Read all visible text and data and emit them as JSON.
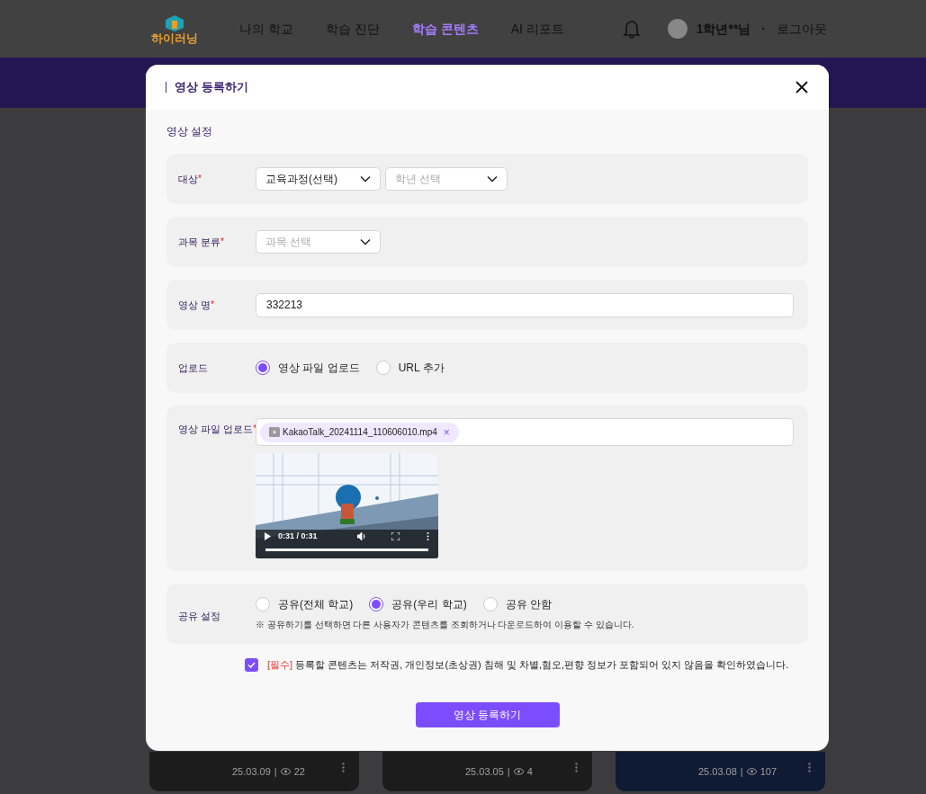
{
  "header": {
    "logo": "하이러닝",
    "nav": [
      {
        "label": "나의 학교",
        "selected": false
      },
      {
        "label": "학습 진단",
        "selected": false
      },
      {
        "label": "학습 콘텐츠",
        "selected": true
      },
      {
        "label": "AI 리포트",
        "selected": false
      }
    ],
    "user": "1학년**님",
    "separator": "·",
    "logout": "로그아웃"
  },
  "cards": [
    {
      "date": "25.03.09",
      "divider": "|",
      "views": "22"
    },
    {
      "date": "25.03.05",
      "divider": "|",
      "views": "4"
    },
    {
      "date": "25.03.08",
      "divider": "|",
      "views": "107"
    }
  ],
  "modal": {
    "title": "영상 등록하기",
    "section_title": "영상 설정",
    "fields": [
      {
        "kind": "selects",
        "label": "대상",
        "required_mark": "*",
        "selects": [
          {
            "value": "교육과정(선택)"
          },
          {
            "placeholder": "학년 선택"
          }
        ]
      },
      {
        "kind": "selects",
        "label": "과목 분류",
        "required_mark": "*",
        "selects": [
          {
            "placeholder": "과목 선택"
          }
        ]
      },
      {
        "kind": "text",
        "label": "영상 명",
        "required_mark": "*",
        "value": "332213"
      },
      {
        "kind": "radios",
        "label": "업로드",
        "options": [
          {
            "label": "영상 파일 업로드",
            "selected": true
          },
          {
            "label": "URL 추가",
            "selected": false
          }
        ]
      },
      {
        "kind": "file",
        "label": "영상 파일 업로드",
        "required_mark": "*",
        "file": "KakaoTalk_20241114_110606010.mp4",
        "remove": "×",
        "time": "0:31 / 0:31",
        "level": 1
      },
      {
        "kind": "radios",
        "label": "공유 설정",
        "options": [
          {
            "label": "공유(전체 학교)",
            "selected": false
          },
          {
            "label": "공유(우리 학교)",
            "selected": true
          },
          {
            "label": "공유 안함",
            "selected": false
          }
        ],
        "note": "※ 공유하기를 선택하면 다른 사용자가 콘텐츠를 조회하거나 다운로드하여 이용할 수 있습니다."
      }
    ],
    "consent": {
      "checked": true,
      "tag": "[필수]",
      "text": "등록할 콘텐츠는 저작권, 개인정보(초상권) 침해 및 차별,혐오,편향 정보가 포함되어 있지 않음을 확인하였습니다."
    },
    "submit": "영상 등록하기"
  }
}
